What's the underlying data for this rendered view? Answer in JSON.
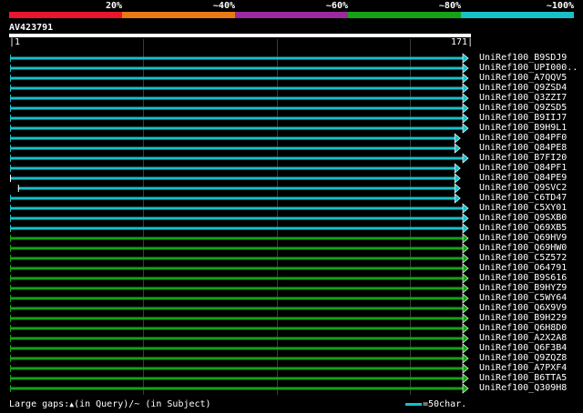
{
  "legend": {
    "segments": [
      {
        "label": "20%",
        "color": "#e8162f"
      },
      {
        "label": "~40%",
        "color": "#e87a16"
      },
      {
        "label": "~60%",
        "color": "#9b2a9e"
      },
      {
        "label": "~80%",
        "color": "#16a216"
      },
      {
        "label": "~100%",
        "color": "#18c0c8"
      }
    ]
  },
  "query": {
    "id": "AV423791",
    "start": 1,
    "end": 171,
    "start_label": "1",
    "end_label": "171"
  },
  "colors": {
    "cyan": "#18c0c8",
    "green": "#16a216",
    "grid": "#3a3a3a",
    "white": "#ffffff"
  },
  "hits": [
    {
      "name": "UniRef100_B9SDJ9",
      "start": 1,
      "end": 171,
      "color": "cyan",
      "arrow": true
    },
    {
      "name": "UniRef100_UPI000..",
      "start": 1,
      "end": 171,
      "color": "cyan",
      "arrow": true
    },
    {
      "name": "UniRef100_A7QQV5",
      "start": 1,
      "end": 171,
      "color": "cyan",
      "arrow": true
    },
    {
      "name": "UniRef100_Q9ZSD4",
      "start": 1,
      "end": 171,
      "color": "cyan",
      "arrow": true
    },
    {
      "name": "UniRef100_Q3ZZI7",
      "start": 1,
      "end": 171,
      "color": "cyan",
      "arrow": true
    },
    {
      "name": "UniRef100_Q9ZSD5",
      "start": 1,
      "end": 171,
      "color": "cyan",
      "arrow": true
    },
    {
      "name": "UniRef100_B9IIJ7",
      "start": 1,
      "end": 171,
      "color": "cyan",
      "arrow": true
    },
    {
      "name": "UniRef100_B9H9L1",
      "start": 1,
      "end": 171,
      "color": "cyan",
      "arrow": true
    },
    {
      "name": "UniRef100_Q84PF0",
      "start": 1,
      "end": 168,
      "color": "cyan",
      "arrow": true
    },
    {
      "name": "UniRef100_Q84PE8",
      "start": 1,
      "end": 168,
      "color": "cyan",
      "arrow": true
    },
    {
      "name": "UniRef100_B7FI20",
      "start": 1,
      "end": 171,
      "color": "cyan",
      "arrow": true
    },
    {
      "name": "UniRef100_Q84PF1",
      "start": 1,
      "end": 168,
      "color": "cyan",
      "arrow": true
    },
    {
      "name": "UniRef100_Q84PE9",
      "start": 1,
      "end": 168,
      "color": "cyan",
      "arrow": true,
      "start_tick": true
    },
    {
      "name": "UniRef100_Q9SVC2",
      "start": 4,
      "end": 168,
      "color": "cyan",
      "arrow": true,
      "start_tick": true
    },
    {
      "name": "UniRef100_C6TD47",
      "start": 1,
      "end": 168,
      "color": "cyan",
      "arrow": true
    },
    {
      "name": "UniRef100_C5XY01",
      "start": 1,
      "end": 171,
      "color": "cyan",
      "arrow": true
    },
    {
      "name": "UniRef100_Q9SXB0",
      "start": 1,
      "end": 171,
      "color": "cyan",
      "arrow": true
    },
    {
      "name": "UniRef100_Q69XB5",
      "start": 1,
      "end": 171,
      "color": "cyan",
      "arrow": true
    },
    {
      "name": "UniRef100_Q69HV9",
      "start": 1,
      "end": 171,
      "color": "green",
      "arrow": true
    },
    {
      "name": "UniRef100_Q69HW0",
      "start": 1,
      "end": 171,
      "color": "green",
      "arrow": true
    },
    {
      "name": "UniRef100_C5Z572",
      "start": 1,
      "end": 171,
      "color": "green",
      "arrow": true
    },
    {
      "name": "UniRef100_O64791",
      "start": 1,
      "end": 171,
      "color": "green",
      "arrow": true
    },
    {
      "name": "UniRef100_B9S616",
      "start": 1,
      "end": 171,
      "color": "green",
      "arrow": true
    },
    {
      "name": "UniRef100_B9HYZ9",
      "start": 1,
      "end": 171,
      "color": "green",
      "arrow": true
    },
    {
      "name": "UniRef100_C5WY64",
      "start": 1,
      "end": 171,
      "color": "green",
      "arrow": true
    },
    {
      "name": "UniRef100_Q6X9V9",
      "start": 1,
      "end": 171,
      "color": "green",
      "arrow": true
    },
    {
      "name": "UniRef100_B9H229",
      "start": 1,
      "end": 171,
      "color": "green",
      "arrow": true
    },
    {
      "name": "UniRef100_Q6H8D0",
      "start": 1,
      "end": 171,
      "color": "green",
      "arrow": true
    },
    {
      "name": "UniRef100_A2X2A8",
      "start": 1,
      "end": 171,
      "color": "green",
      "arrow": true
    },
    {
      "name": "UniRef100_Q6F3B4",
      "start": 1,
      "end": 171,
      "color": "green",
      "arrow": true
    },
    {
      "name": "UniRef100_Q9ZQZ8",
      "start": 1,
      "end": 171,
      "color": "green",
      "arrow": true
    },
    {
      "name": "UniRef100_A7PXF4",
      "start": 1,
      "end": 171,
      "color": "green",
      "arrow": true
    },
    {
      "name": "UniRef100_B6TTA5",
      "start": 1,
      "end": 171,
      "color": "green",
      "arrow": true
    },
    {
      "name": "UniRef100_Q309H8",
      "start": 1,
      "end": 171,
      "color": "green",
      "arrow": true
    }
  ],
  "footer": {
    "text_before": "Large gaps:",
    "glyph": "▲",
    "text_after": "(in Query)/~ (in Subject)"
  },
  "scale": {
    "label": "=50char.",
    "color": "#18c0c8"
  }
}
